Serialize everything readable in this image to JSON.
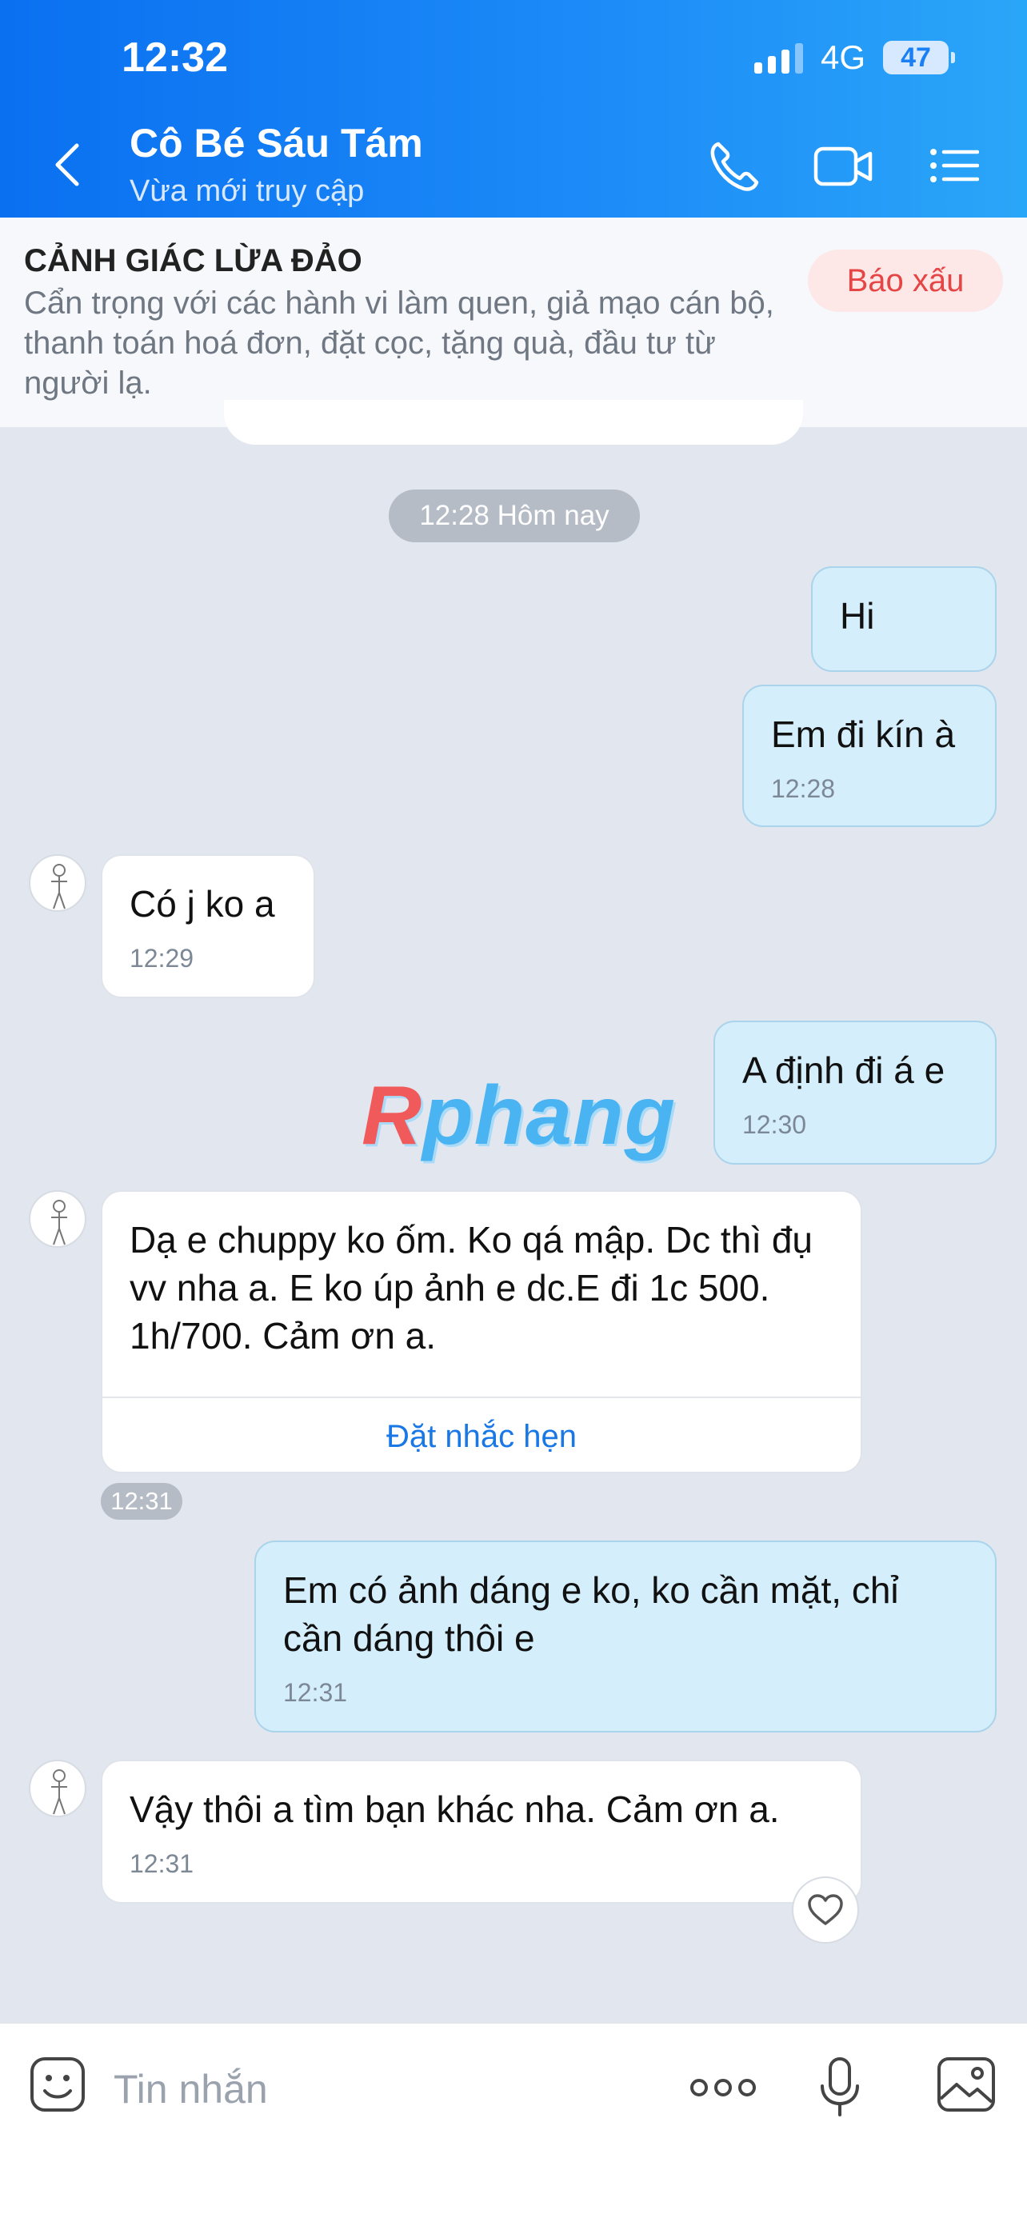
{
  "status_bar": {
    "time": "12:32",
    "network": "4G",
    "battery": "47"
  },
  "header": {
    "contact_name": "Cô Bé Sáu Tám",
    "contact_status": "Vừa mới truy cập"
  },
  "warning": {
    "title": "CẢNH GIÁC LỪA ĐẢO",
    "text": "Cẩn trọng với các hành vi làm quen, giả mạo cán bộ, thanh toán hoá đơn, đặt cọc, tặng quà, đầu tư từ người lạ.",
    "report_label": "Báo xấu"
  },
  "date_divider": "12:28 Hôm nay",
  "messages": [
    {
      "dir": "out",
      "text": "Hi",
      "time": ""
    },
    {
      "dir": "out",
      "text": "Em đi kín à",
      "time": "12:28"
    },
    {
      "dir": "in",
      "text": "Có j ko a",
      "time": "12:29"
    },
    {
      "dir": "out",
      "text": "A định đi á e",
      "time": "12:30"
    },
    {
      "dir": "in",
      "text": "Dạ e chuppy ko ốm. Ko qá mập. Dc thì đụ vv nha a. E ko úp ảnh e dc.E đi 1c 500. 1h/700. Cảm ơn a.",
      "time": "12:31",
      "action": "Đặt nhắc hẹn"
    },
    {
      "dir": "out",
      "text": "Em có ảnh dáng e ko, ko cần mặt, chỉ cần dáng thôi e",
      "time": "12:31"
    },
    {
      "dir": "in",
      "text": "Vậy thôi a tìm bạn khác nha. Cảm ơn a.",
      "time": "12:31"
    }
  ],
  "watermark": {
    "r": "R",
    "rest": "phang"
  },
  "composer": {
    "placeholder": "Tin nhắn"
  },
  "colors": {
    "header_start": "#0a70f0",
    "header_end": "#2aa6f8",
    "outgoing_bubble": "#d4eefb",
    "incoming_bubble": "#ffffff",
    "report": "#e64545",
    "link": "#1978e5"
  },
  "icons": [
    "back-arrow-icon",
    "phone-icon",
    "video-call-icon",
    "menu-list-icon",
    "emoji-icon",
    "more-icon",
    "microphone-icon",
    "image-icon",
    "heart-icon"
  ]
}
